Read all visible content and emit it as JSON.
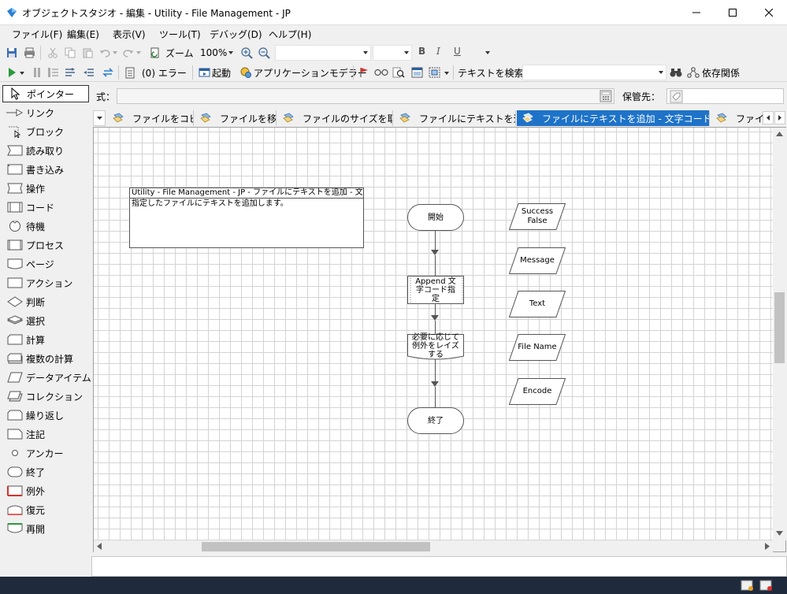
{
  "window": {
    "title": "オブジェクトスタジオ - 編集 - Utility - File Management - JP"
  },
  "menu": [
    "ファイル(F)",
    "編集(E)",
    "表示(V)",
    "ツール(T)",
    "デバッグ(D)",
    "ヘルプ(H)"
  ],
  "toolbar1": {
    "zoom_label": "ズーム",
    "zoom_value": "100%",
    "bold": "B",
    "italic": "I",
    "underline": "U"
  },
  "toolbar2": {
    "error_count": "(0) エラー",
    "launch": "起動",
    "app_modeler": "アプリケーションモデラー",
    "search_text": "テキストを検索",
    "dependencies": "依存関係"
  },
  "sidebar": {
    "tools": [
      "ポインター",
      "リンク",
      "ブロック",
      "読み取り",
      "書き込み",
      "操作",
      "コード",
      "待機",
      "プロセス",
      "ページ",
      "アクション",
      "判断",
      "選択",
      "計算",
      "複数の計算",
      "データアイテム",
      "コレクション",
      "繰り返し",
      "注記",
      "アンカー",
      "終了",
      "例外",
      "復元",
      "再開"
    ],
    "selected_index": 0
  },
  "expression_bar": {
    "expr_label": "式：",
    "store_label": "保管先："
  },
  "tabs": [
    "ファイルをコピー",
    "ファイルを移動",
    "ファイルのサイズを取得",
    "ファイルにテキストを追加",
    "ファイルにテキストを追加 - 文字コード指定",
    "ファイル"
  ],
  "active_tab_index": 4,
  "diagram": {
    "note_title": "Utility - File Management - JP - ファイルにテキストを追加 - 文字コ",
    "note_body": "指定したファイルにテキストを追加します。",
    "start": "開始",
    "action": "Append 文字コード指定",
    "raise": "必要に応じて例外をレイズする",
    "end": "終了",
    "data_items": [
      "Success\nFalse",
      "Message",
      "Text",
      "File Name",
      "Encode"
    ]
  },
  "colors": {
    "active_tab": "#1e73c8",
    "grid": "#d4d4d4",
    "taskbar": "#1f2b3c"
  }
}
